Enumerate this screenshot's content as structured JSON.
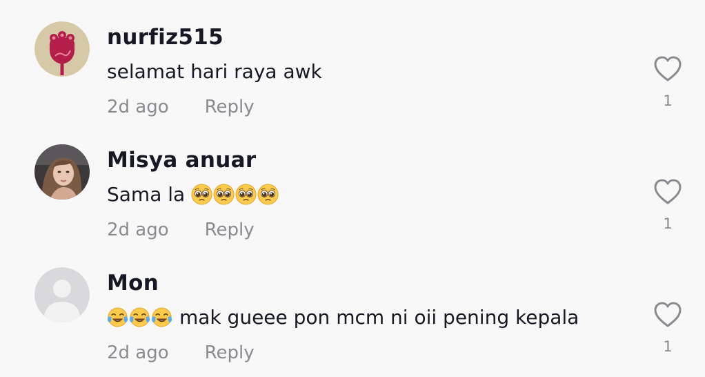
{
  "comments": [
    {
      "username": "nurfiz515",
      "emoji_before": [],
      "text": "selamat hari raya awk",
      "emoji_after": [],
      "time": "2d ago",
      "reply_label": "Reply",
      "likes": "1",
      "avatar": "red-flower-illustration",
      "colors": {
        "avatar_bg": "#d6c9a8",
        "avatar_fg": "#b41f4a"
      }
    },
    {
      "username": "Misya anuar",
      "emoji_before": [],
      "text": "Sama la",
      "emoji_after": [
        "pleading-face",
        "pleading-face",
        "pleading-face",
        "pleading-face"
      ],
      "time": "2d ago",
      "reply_label": "Reply",
      "likes": "1",
      "avatar": "photo-woman-in-car"
    },
    {
      "username": "Mon",
      "emoji_before": [
        "tears-of-joy-face",
        "tears-of-joy-face",
        "tears-of-joy-face"
      ],
      "text": "mak gueee pon mcm ni oii pening kepala",
      "emoji_after": [],
      "time": "2d ago",
      "reply_label": "Reply",
      "likes": "1",
      "avatar": "default-person-placeholder",
      "colors": {
        "avatar_bg": "#d9d9db",
        "avatar_fg": "#f2f2f2"
      }
    }
  ],
  "icons": {
    "like": "heart-outline-icon"
  },
  "colors": {
    "background": "#f8f8f8",
    "text": "#161823",
    "muted": "#8a8b91",
    "heart": "#8a8b91"
  }
}
